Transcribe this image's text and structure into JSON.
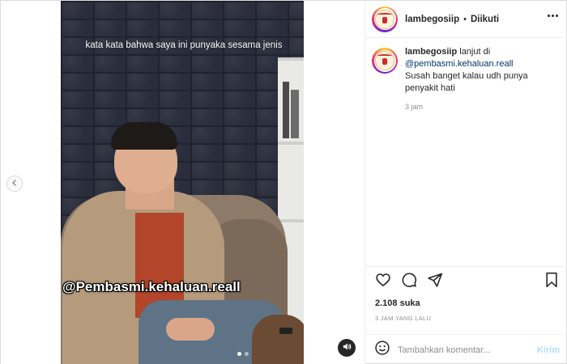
{
  "post": {
    "username": "lambegosiip",
    "separator": "•",
    "follow_label": "Diikuti",
    "caption": {
      "username": "lambegosiip",
      "text_1": "lanjut di",
      "mention": "@pembasmi.kehaluan.reall",
      "text_2": "Susah banget kalau udh punya penyakit hati",
      "time": "3 jam"
    },
    "likes": "2.108 suka",
    "time_ago": "3 JAM YANG LALU"
  },
  "media": {
    "subtitle": "kata kata bahwa saya ini punyaka sesama jenis",
    "watermark": "@Pembasmi.kehaluan.reall",
    "carousel": {
      "count": 2,
      "active_index": 1
    }
  },
  "comment_box": {
    "placeholder": "Tambahkan komentar...",
    "post_label": "Kirim"
  },
  "icons": {
    "prev": "chevron-left-icon",
    "mute": "speaker-icon",
    "more": "more-horizontal-icon",
    "like": "heart-icon",
    "comment": "comment-icon",
    "share": "share-icon",
    "save": "bookmark-icon",
    "emoji": "emoji-icon"
  },
  "colors": {
    "mention": "#00376b",
    "post_button_disabled": "#b2dffc",
    "muted_text": "#8e8e8e"
  }
}
